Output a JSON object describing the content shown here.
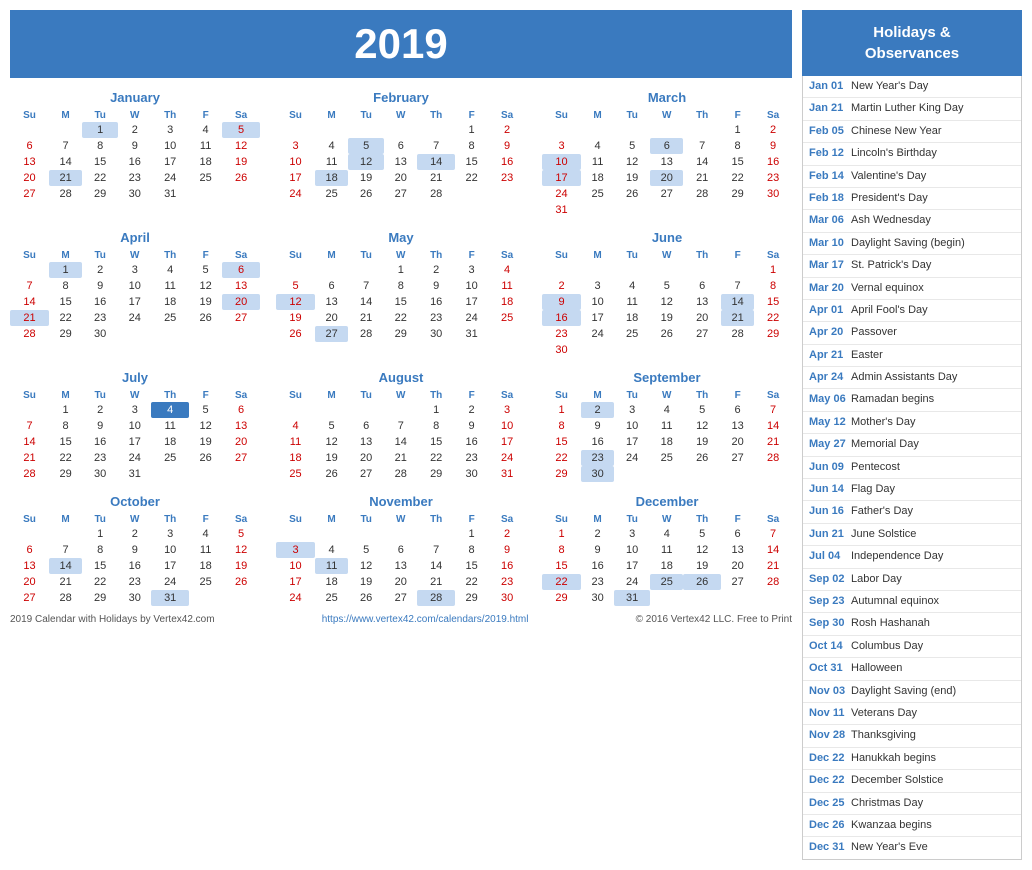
{
  "year": "2019",
  "holidays_header": "Holidays &\nObservances",
  "months": [
    {
      "name": "January",
      "weeks": [
        [
          "",
          "",
          "1",
          "2",
          "3",
          "4",
          "5"
        ],
        [
          "6",
          "7",
          "8",
          "9",
          "10",
          "11",
          "12"
        ],
        [
          "13",
          "14",
          "15",
          "16",
          "17",
          "18",
          "19"
        ],
        [
          "20",
          "21",
          "22",
          "23",
          "24",
          "25",
          "26"
        ],
        [
          "27",
          "28",
          "29",
          "30",
          "31",
          "",
          ""
        ]
      ],
      "highlights": {
        "1": "holiday",
        "5": "sat-holiday",
        "21": "holiday"
      }
    },
    {
      "name": "February",
      "weeks": [
        [
          "",
          "",
          "",
          "",
          "",
          "1",
          "2"
        ],
        [
          "3",
          "4",
          "5",
          "6",
          "7",
          "8",
          "9"
        ],
        [
          "10",
          "11",
          "12",
          "13",
          "14",
          "15",
          "16"
        ],
        [
          "17",
          "18",
          "19",
          "20",
          "21",
          "22",
          "23"
        ],
        [
          "24",
          "25",
          "26",
          "27",
          "28",
          "",
          ""
        ]
      ],
      "highlights": {
        "5": "holiday",
        "12": "holiday",
        "14": "holiday",
        "18": "holiday"
      }
    },
    {
      "name": "March",
      "weeks": [
        [
          "",
          "",
          "",
          "",
          "",
          "1",
          "2"
        ],
        [
          "3",
          "4",
          "5",
          "6",
          "7",
          "8",
          "9"
        ],
        [
          "10",
          "11",
          "12",
          "13",
          "14",
          "15",
          "16"
        ],
        [
          "17",
          "18",
          "19",
          "20",
          "21",
          "22",
          "23"
        ],
        [
          "24",
          "25",
          "26",
          "27",
          "28",
          "29",
          "30"
        ],
        [
          "31",
          "",
          "",
          "",
          "",
          "",
          ""
        ]
      ],
      "highlights": {
        "6": "holiday",
        "10": "holiday",
        "17": "holiday",
        "20": "holiday"
      }
    },
    {
      "name": "April",
      "weeks": [
        [
          "",
          "1",
          "2",
          "3",
          "4",
          "5",
          "6"
        ],
        [
          "7",
          "8",
          "9",
          "10",
          "11",
          "12",
          "13"
        ],
        [
          "14",
          "15",
          "16",
          "17",
          "18",
          "19",
          "20"
        ],
        [
          "21",
          "22",
          "23",
          "24",
          "25",
          "26",
          "27"
        ],
        [
          "28",
          "29",
          "30",
          "",
          "",
          "",
          ""
        ]
      ],
      "highlights": {
        "1": "holiday",
        "6": "sat-holiday",
        "20": "holiday",
        "21": "holiday"
      }
    },
    {
      "name": "May",
      "weeks": [
        [
          "",
          "",
          "",
          "1",
          "2",
          "3",
          "4"
        ],
        [
          "5",
          "6",
          "7",
          "8",
          "9",
          "10",
          "11"
        ],
        [
          "12",
          "13",
          "14",
          "15",
          "16",
          "17",
          "18"
        ],
        [
          "19",
          "20",
          "21",
          "22",
          "23",
          "24",
          "25"
        ],
        [
          "26",
          "27",
          "28",
          "29",
          "30",
          "31",
          ""
        ]
      ],
      "highlights": {
        "12": "holiday",
        "27": "holiday"
      }
    },
    {
      "name": "June",
      "weeks": [
        [
          "",
          "",
          "",
          "",
          "",
          "",
          "1"
        ],
        [
          "2",
          "3",
          "4",
          "5",
          "6",
          "7",
          "8"
        ],
        [
          "9",
          "10",
          "11",
          "12",
          "13",
          "14",
          "15"
        ],
        [
          "16",
          "17",
          "18",
          "19",
          "20",
          "21",
          "22"
        ],
        [
          "23",
          "24",
          "25",
          "26",
          "27",
          "28",
          "29"
        ],
        [
          "30",
          "",
          "",
          "",
          "",
          "",
          ""
        ]
      ],
      "highlights": {
        "9": "holiday",
        "14": "holiday",
        "16": "holiday",
        "21": "holiday"
      }
    },
    {
      "name": "July",
      "weeks": [
        [
          "",
          "1",
          "2",
          "3",
          "4",
          "5",
          "6"
        ],
        [
          "7",
          "8",
          "9",
          "10",
          "11",
          "12",
          "13"
        ],
        [
          "14",
          "15",
          "16",
          "17",
          "18",
          "19",
          "20"
        ],
        [
          "21",
          "22",
          "23",
          "24",
          "25",
          "26",
          "27"
        ],
        [
          "28",
          "29",
          "30",
          "31",
          "",
          "",
          ""
        ]
      ],
      "highlights": {
        "4": "today"
      }
    },
    {
      "name": "August",
      "weeks": [
        [
          "",
          "",
          "",
          "",
          "1",
          "2",
          "3"
        ],
        [
          "4",
          "5",
          "6",
          "7",
          "8",
          "9",
          "10"
        ],
        [
          "11",
          "12",
          "13",
          "14",
          "15",
          "16",
          "17"
        ],
        [
          "18",
          "19",
          "20",
          "21",
          "22",
          "23",
          "24"
        ],
        [
          "25",
          "26",
          "27",
          "28",
          "29",
          "30",
          "31"
        ]
      ],
      "highlights": {}
    },
    {
      "name": "September",
      "weeks": [
        [
          "1",
          "2",
          "3",
          "4",
          "5",
          "6",
          "7"
        ],
        [
          "8",
          "9",
          "10",
          "11",
          "12",
          "13",
          "14"
        ],
        [
          "15",
          "16",
          "17",
          "18",
          "19",
          "20",
          "21"
        ],
        [
          "22",
          "23",
          "24",
          "25",
          "26",
          "27",
          "28"
        ],
        [
          "29",
          "30",
          "",
          "",
          "",
          "",
          ""
        ]
      ],
      "highlights": {
        "2": "holiday",
        "23": "holiday",
        "30": "holiday"
      }
    },
    {
      "name": "October",
      "weeks": [
        [
          "",
          "",
          "1",
          "2",
          "3",
          "4",
          "5"
        ],
        [
          "6",
          "7",
          "8",
          "9",
          "10",
          "11",
          "12"
        ],
        [
          "13",
          "14",
          "15",
          "16",
          "17",
          "18",
          "19"
        ],
        [
          "20",
          "21",
          "22",
          "23",
          "24",
          "25",
          "26"
        ],
        [
          "27",
          "28",
          "29",
          "30",
          "31",
          "",
          ""
        ]
      ],
      "highlights": {
        "14": "holiday",
        "31": "holiday"
      }
    },
    {
      "name": "November",
      "weeks": [
        [
          "",
          "",
          "",
          "",
          "",
          "1",
          "2"
        ],
        [
          "3",
          "4",
          "5",
          "6",
          "7",
          "8",
          "9"
        ],
        [
          "10",
          "11",
          "12",
          "13",
          "14",
          "15",
          "16"
        ],
        [
          "17",
          "18",
          "19",
          "20",
          "21",
          "22",
          "23"
        ],
        [
          "24",
          "25",
          "26",
          "27",
          "28",
          "29",
          "30"
        ]
      ],
      "highlights": {
        "3": "holiday",
        "11": "holiday",
        "28": "holiday"
      }
    },
    {
      "name": "December",
      "weeks": [
        [
          "1",
          "2",
          "3",
          "4",
          "5",
          "6",
          "7"
        ],
        [
          "8",
          "9",
          "10",
          "11",
          "12",
          "13",
          "14"
        ],
        [
          "15",
          "16",
          "17",
          "18",
          "19",
          "20",
          "21"
        ],
        [
          "22",
          "23",
          "24",
          "25",
          "26",
          "27",
          "28"
        ],
        [
          "29",
          "30",
          "31",
          "",
          "",
          "",
          ""
        ]
      ],
      "highlights": {
        "22": "holiday",
        "25": "holiday",
        "26": "holiday",
        "31": "holiday"
      }
    }
  ],
  "holidays": [
    {
      "date": "Jan 01",
      "name": "New Year's Day"
    },
    {
      "date": "Jan 21",
      "name": "Martin Luther King Day"
    },
    {
      "date": "Feb 05",
      "name": "Chinese New Year"
    },
    {
      "date": "Feb 12",
      "name": "Lincoln's Birthday"
    },
    {
      "date": "Feb 14",
      "name": "Valentine's Day"
    },
    {
      "date": "Feb 18",
      "name": "President's Day"
    },
    {
      "date": "Mar 06",
      "name": "Ash Wednesday"
    },
    {
      "date": "Mar 10",
      "name": "Daylight Saving (begin)"
    },
    {
      "date": "Mar 17",
      "name": "St. Patrick's Day"
    },
    {
      "date": "Mar 20",
      "name": "Vernal equinox"
    },
    {
      "date": "Apr 01",
      "name": "April Fool's Day"
    },
    {
      "date": "Apr 20",
      "name": "Passover"
    },
    {
      "date": "Apr 21",
      "name": "Easter"
    },
    {
      "date": "Apr 24",
      "name": "Admin Assistants Day"
    },
    {
      "date": "May 06",
      "name": "Ramadan begins"
    },
    {
      "date": "May 12",
      "name": "Mother's Day"
    },
    {
      "date": "May 27",
      "name": "Memorial Day"
    },
    {
      "date": "Jun 09",
      "name": "Pentecost"
    },
    {
      "date": "Jun 14",
      "name": "Flag Day"
    },
    {
      "date": "Jun 16",
      "name": "Father's Day"
    },
    {
      "date": "Jun 21",
      "name": "June Solstice"
    },
    {
      "date": "Jul 04",
      "name": "Independence Day"
    },
    {
      "date": "Sep 02",
      "name": "Labor Day"
    },
    {
      "date": "Sep 23",
      "name": "Autumnal equinox"
    },
    {
      "date": "Sep 30",
      "name": "Rosh Hashanah"
    },
    {
      "date": "Oct 14",
      "name": "Columbus Day"
    },
    {
      "date": "Oct 31",
      "name": "Halloween"
    },
    {
      "date": "Nov 03",
      "name": "Daylight Saving (end)"
    },
    {
      "date": "Nov 11",
      "name": "Veterans Day"
    },
    {
      "date": "Nov 28",
      "name": "Thanksgiving"
    },
    {
      "date": "Dec 22",
      "name": "Hanukkah begins"
    },
    {
      "date": "Dec 22",
      "name": "December Solstice"
    },
    {
      "date": "Dec 25",
      "name": "Christmas Day"
    },
    {
      "date": "Dec 26",
      "name": "Kwanzaa begins"
    },
    {
      "date": "Dec 31",
      "name": "New Year's Eve"
    }
  ],
  "footer": {
    "left": "2019 Calendar with Holidays by Vertex42.com",
    "center": "https://www.vertex42.com/calendars/2019.html",
    "right": "© 2016 Vertex42 LLC. Free to Print"
  }
}
